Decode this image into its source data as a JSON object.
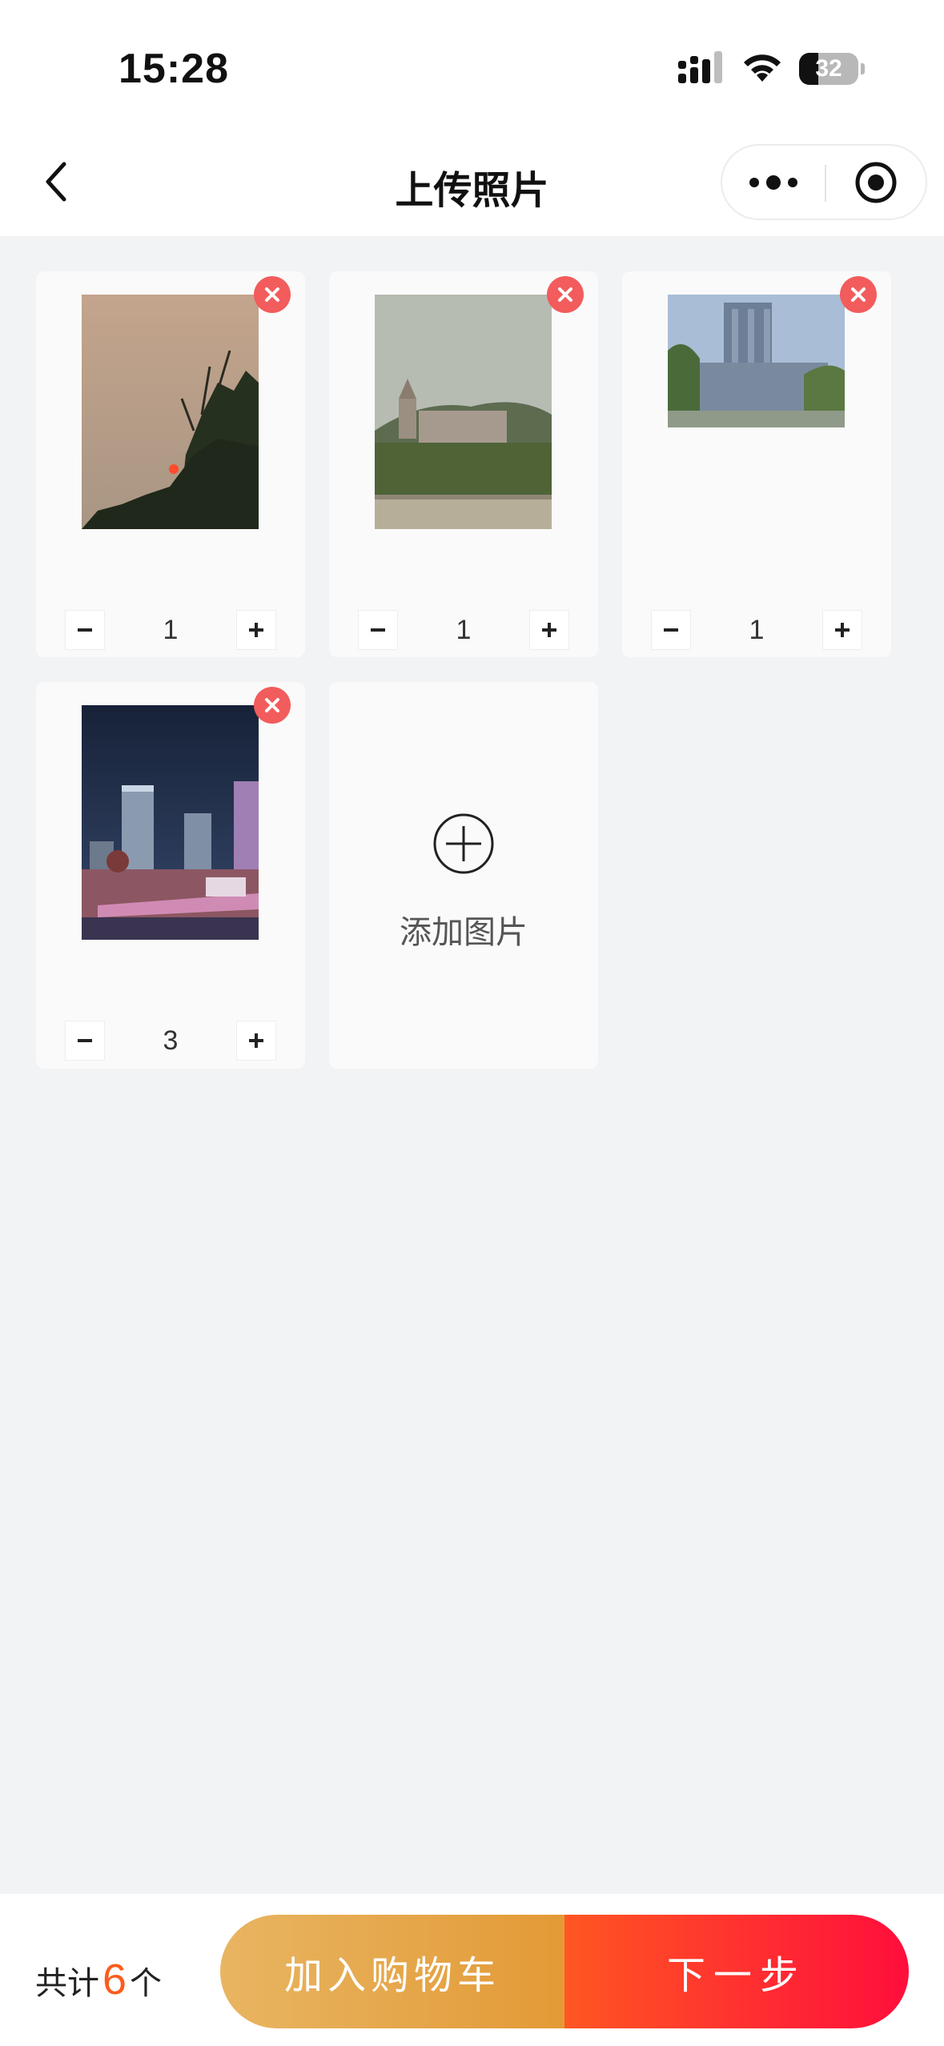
{
  "status_bar": {
    "time": "15:28",
    "battery": "32",
    "battery_level": 0.32
  },
  "nav": {
    "title": "上传照片"
  },
  "photos": [
    {
      "quantity": "1"
    },
    {
      "quantity": "1"
    },
    {
      "quantity": "1"
    },
    {
      "quantity": "3"
    }
  ],
  "add_card": {
    "label": "添加图片"
  },
  "footer": {
    "total_prefix": "共计",
    "total_count": "6",
    "total_suffix": "个",
    "add_to_cart": "加入购物车",
    "next_step": "下一步"
  },
  "colors": {
    "accent_orange": "#fa5d1d",
    "remove_red": "#f25c5c",
    "cart_gradient": [
      "#e8b562",
      "#e39a36"
    ],
    "next_gradient": [
      "#ff5622",
      "#ff0e3c"
    ]
  }
}
